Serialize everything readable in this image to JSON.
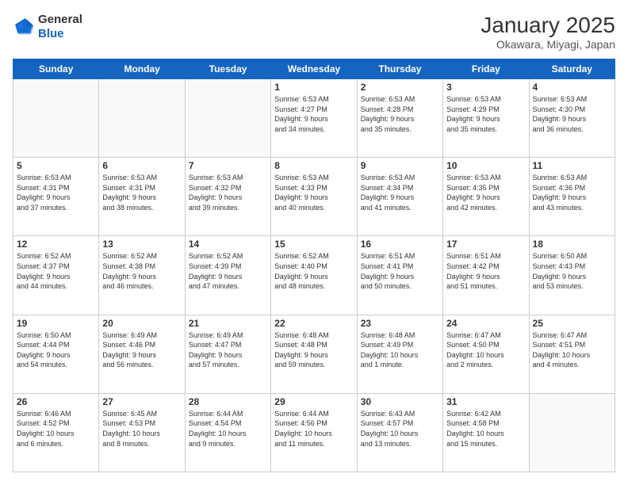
{
  "logo": {
    "line1": "General",
    "line2": "Blue"
  },
  "title": "January 2025",
  "subtitle": "Okawara, Miyagi, Japan",
  "days_header": [
    "Sunday",
    "Monday",
    "Tuesday",
    "Wednesday",
    "Thursday",
    "Friday",
    "Saturday"
  ],
  "weeks": [
    [
      {
        "day": "",
        "detail": ""
      },
      {
        "day": "",
        "detail": ""
      },
      {
        "day": "",
        "detail": ""
      },
      {
        "day": "1",
        "detail": "Sunrise: 6:53 AM\nSunset: 4:27 PM\nDaylight: 9 hours\nand 34 minutes."
      },
      {
        "day": "2",
        "detail": "Sunrise: 6:53 AM\nSunset: 4:28 PM\nDaylight: 9 hours\nand 35 minutes."
      },
      {
        "day": "3",
        "detail": "Sunrise: 6:53 AM\nSunset: 4:29 PM\nDaylight: 9 hours\nand 35 minutes."
      },
      {
        "day": "4",
        "detail": "Sunrise: 6:53 AM\nSunset: 4:30 PM\nDaylight: 9 hours\nand 36 minutes."
      }
    ],
    [
      {
        "day": "5",
        "detail": "Sunrise: 6:53 AM\nSunset: 4:31 PM\nDaylight: 9 hours\nand 37 minutes."
      },
      {
        "day": "6",
        "detail": "Sunrise: 6:53 AM\nSunset: 4:31 PM\nDaylight: 9 hours\nand 38 minutes."
      },
      {
        "day": "7",
        "detail": "Sunrise: 6:53 AM\nSunset: 4:32 PM\nDaylight: 9 hours\nand 39 minutes."
      },
      {
        "day": "8",
        "detail": "Sunrise: 6:53 AM\nSunset: 4:33 PM\nDaylight: 9 hours\nand 40 minutes."
      },
      {
        "day": "9",
        "detail": "Sunrise: 6:53 AM\nSunset: 4:34 PM\nDaylight: 9 hours\nand 41 minutes."
      },
      {
        "day": "10",
        "detail": "Sunrise: 6:53 AM\nSunset: 4:35 PM\nDaylight: 9 hours\nand 42 minutes."
      },
      {
        "day": "11",
        "detail": "Sunrise: 6:53 AM\nSunset: 4:36 PM\nDaylight: 9 hours\nand 43 minutes."
      }
    ],
    [
      {
        "day": "12",
        "detail": "Sunrise: 6:52 AM\nSunset: 4:37 PM\nDaylight: 9 hours\nand 44 minutes."
      },
      {
        "day": "13",
        "detail": "Sunrise: 6:52 AM\nSunset: 4:38 PM\nDaylight: 9 hours\nand 46 minutes."
      },
      {
        "day": "14",
        "detail": "Sunrise: 6:52 AM\nSunset: 4:39 PM\nDaylight: 9 hours\nand 47 minutes."
      },
      {
        "day": "15",
        "detail": "Sunrise: 6:52 AM\nSunset: 4:40 PM\nDaylight: 9 hours\nand 48 minutes."
      },
      {
        "day": "16",
        "detail": "Sunrise: 6:51 AM\nSunset: 4:41 PM\nDaylight: 9 hours\nand 50 minutes."
      },
      {
        "day": "17",
        "detail": "Sunrise: 6:51 AM\nSunset: 4:42 PM\nDaylight: 9 hours\nand 51 minutes."
      },
      {
        "day": "18",
        "detail": "Sunrise: 6:50 AM\nSunset: 4:43 PM\nDaylight: 9 hours\nand 53 minutes."
      }
    ],
    [
      {
        "day": "19",
        "detail": "Sunrise: 6:50 AM\nSunset: 4:44 PM\nDaylight: 9 hours\nand 54 minutes."
      },
      {
        "day": "20",
        "detail": "Sunrise: 6:49 AM\nSunset: 4:46 PM\nDaylight: 9 hours\nand 56 minutes."
      },
      {
        "day": "21",
        "detail": "Sunrise: 6:49 AM\nSunset: 4:47 PM\nDaylight: 9 hours\nand 57 minutes."
      },
      {
        "day": "22",
        "detail": "Sunrise: 6:48 AM\nSunset: 4:48 PM\nDaylight: 9 hours\nand 59 minutes."
      },
      {
        "day": "23",
        "detail": "Sunrise: 6:48 AM\nSunset: 4:49 PM\nDaylight: 10 hours\nand 1 minute."
      },
      {
        "day": "24",
        "detail": "Sunrise: 6:47 AM\nSunset: 4:50 PM\nDaylight: 10 hours\nand 2 minutes."
      },
      {
        "day": "25",
        "detail": "Sunrise: 6:47 AM\nSunset: 4:51 PM\nDaylight: 10 hours\nand 4 minutes."
      }
    ],
    [
      {
        "day": "26",
        "detail": "Sunrise: 6:46 AM\nSunset: 4:52 PM\nDaylight: 10 hours\nand 6 minutes."
      },
      {
        "day": "27",
        "detail": "Sunrise: 6:45 AM\nSunset: 4:53 PM\nDaylight: 10 hours\nand 8 minutes."
      },
      {
        "day": "28",
        "detail": "Sunrise: 6:44 AM\nSunset: 4:54 PM\nDaylight: 10 hours\nand 9 minutes."
      },
      {
        "day": "29",
        "detail": "Sunrise: 6:44 AM\nSunset: 4:56 PM\nDaylight: 10 hours\nand 11 minutes."
      },
      {
        "day": "30",
        "detail": "Sunrise: 6:43 AM\nSunset: 4:57 PM\nDaylight: 10 hours\nand 13 minutes."
      },
      {
        "day": "31",
        "detail": "Sunrise: 6:42 AM\nSunset: 4:58 PM\nDaylight: 10 hours\nand 15 minutes."
      },
      {
        "day": "",
        "detail": ""
      }
    ]
  ]
}
